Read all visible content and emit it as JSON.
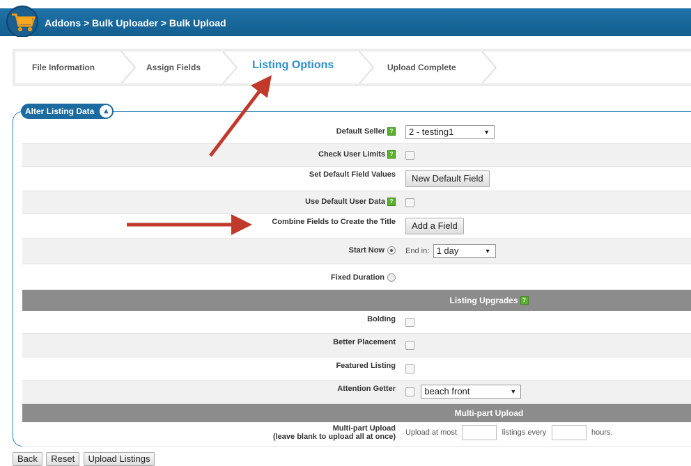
{
  "header": {
    "breadcrumb": "Addons > Bulk Uploader > Bulk Upload"
  },
  "steps": [
    {
      "label": "File Information",
      "active": false
    },
    {
      "label": "Assign Fields",
      "active": false
    },
    {
      "label": "Listing Options",
      "active": true
    },
    {
      "label": "Upload Complete",
      "active": false
    }
  ],
  "panel": {
    "legend": "Alter Listing Data",
    "toggle_icon": "▲"
  },
  "form": {
    "default_seller_label": "Default Seller",
    "default_seller_value": "2 - testing1",
    "check_user_limits_label": "Check User Limits",
    "set_default_field_values_label": "Set Default Field Values",
    "new_default_field_button": "New Default Field",
    "use_default_user_data_label": "Use Default User Data",
    "combine_fields_label": "Combine Fields to Create the Title",
    "add_field_button": "Add a Field",
    "start_now_label": "Start Now",
    "end_in_label": "End in:",
    "end_in_value": "1 day",
    "fixed_duration_label": "Fixed Duration"
  },
  "upgrades": {
    "section_title": "Listing Upgrades",
    "bolding_label": "Bolding",
    "better_placement_label": "Better Placement",
    "featured_listing_label": "Featured Listing",
    "attention_getter_label": "Attention Getter",
    "attention_getter_value": "beach front"
  },
  "multipart": {
    "section_title": "Multi-part Upload",
    "label_line1": "Multi-part Upload",
    "label_line2": "(leave blank to upload all at once)",
    "upload_at_most": "Upload at most",
    "listings_every": "listings every",
    "hours": "hours."
  },
  "buttons": {
    "back": "Back",
    "reset": "Reset",
    "upload_listings": "Upload Listings"
  },
  "icons": {
    "logo": "cart-logo-icon",
    "help": "help-icon",
    "toggle": "collapse-icon",
    "dropdown": "chevron-down-icon",
    "annotation": "red-arrow-icon"
  },
  "colors": {
    "header_blue": "#1f73a8",
    "active_step": "#2a8ec9",
    "section_gray": "#8c8c8c",
    "help_green": "#5cb030",
    "annotation_red": "#c0392b"
  }
}
